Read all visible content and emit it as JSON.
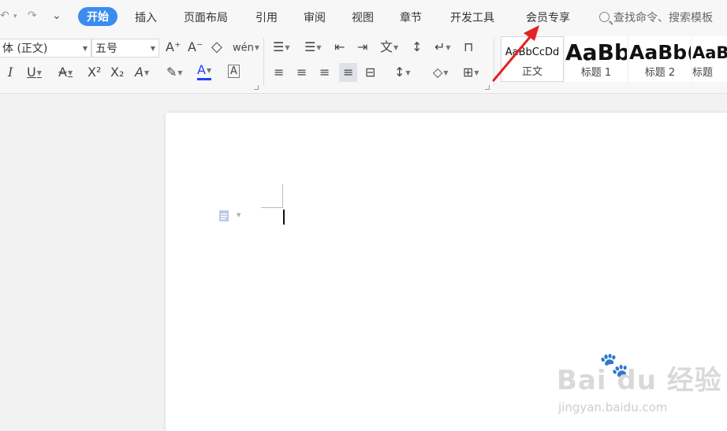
{
  "quick_access": {
    "undo_icon": "↶",
    "undo_caret": "▾",
    "redo_icon": "↷",
    "customize_icon": "⌄"
  },
  "menu": {
    "tabs": [
      "开始",
      "插入",
      "页面布局",
      "引用",
      "审阅",
      "视图",
      "章节",
      "开发工具",
      "会员专享"
    ],
    "active": "开始",
    "search_label": "查找命令、搜索模板"
  },
  "font": {
    "family": "体 (正文)",
    "size": "五号"
  },
  "font_tools": {
    "grow": "A⁺",
    "shrink": "A⁻",
    "clear": "◇",
    "phonetic": "wén",
    "italic": "I",
    "underline": "U",
    "strike": "A",
    "superscript": "X²",
    "subscript": "X₂",
    "text_effect": "A",
    "highlight": "✎",
    "font_color": "A",
    "char_border": "A"
  },
  "paragraph_tools": {
    "bullets": "☰",
    "numbering": "☰",
    "outdent": "⇤",
    "indent": "⇥",
    "cn_layout": "文",
    "sort": "↕",
    "show_marks": "↵",
    "tabs": "⊓",
    "align_left": "≡",
    "center": "≡",
    "align_right": "≡",
    "justify": "≡",
    "distribute": "⊟",
    "line_spacing": "↕",
    "shading": "◇",
    "borders": "⊞"
  },
  "styles": [
    {
      "preview": "AaBbCcDd",
      "label": "正文"
    },
    {
      "preview": "AaBb",
      "label": "标题 1"
    },
    {
      "preview": "AaBb(",
      "label": "标题 2"
    },
    {
      "preview": "AaBb",
      "label": "标题"
    }
  ],
  "colors": {
    "accent": "#3b8cf0",
    "arrow": "#e32323",
    "font_color_bar": "#2040ff"
  },
  "watermark": {
    "main": "Bai du 经验",
    "sub": "jingyan.baidu.com",
    "paw": "🐾"
  }
}
